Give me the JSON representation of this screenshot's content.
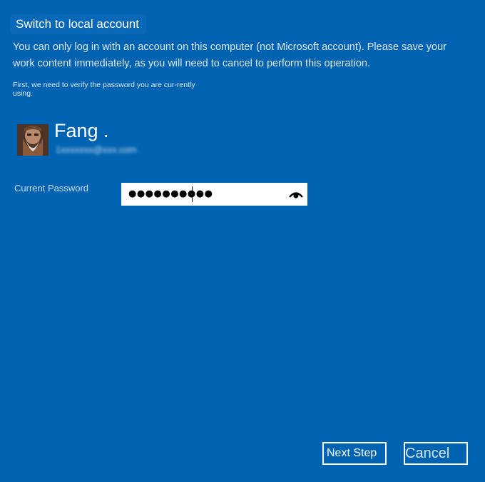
{
  "dialog": {
    "title": "Switch to local account",
    "description": "You can only log in with an account on this computer (not Microsoft account). Please save your work content immediately, as you will need to cancel to perform this operation.",
    "verify_note": "First, we need to verify the password you are cur-rently using."
  },
  "user": {
    "name": "Fang .",
    "email": "1xxxxxxx@xxx.com"
  },
  "password": {
    "label": "Current Password",
    "masked_value": "●●●●●●●●●●",
    "reveal_icon": "eye-icon"
  },
  "buttons": {
    "next_label": "Next Step",
    "cancel_label": "Cancel"
  },
  "colors": {
    "background": "#0063b1",
    "text": "#ffffff"
  }
}
